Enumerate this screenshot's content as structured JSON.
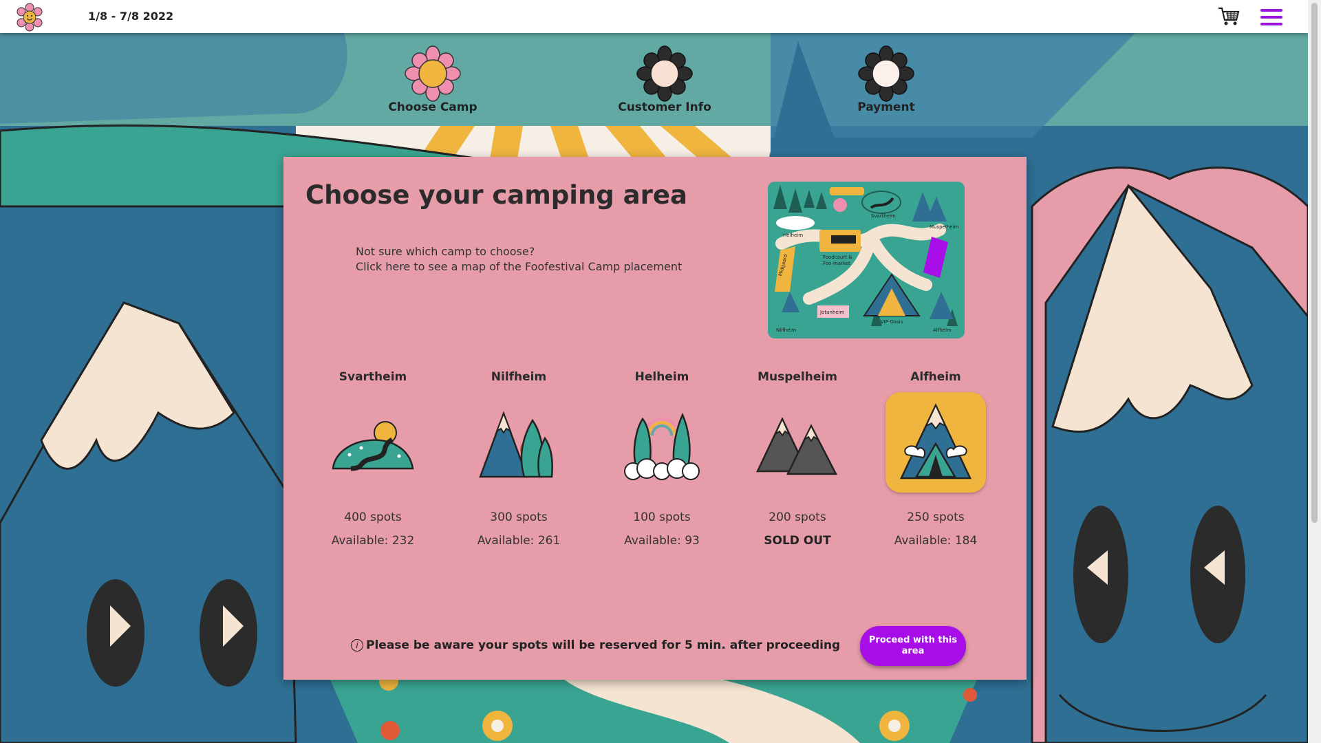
{
  "header": {
    "date_range": "1/8 - 7/8 2022",
    "logo_icon": "flower-logo-icon",
    "cart_icon": "shopping-cart-icon",
    "menu_icon": "hamburger-menu-icon"
  },
  "steps": [
    {
      "label": "Choose Camp",
      "active": true
    },
    {
      "label": "Customer Info",
      "active": false
    },
    {
      "label": "Payment",
      "active": false
    }
  ],
  "main": {
    "title": "Choose your camping area",
    "help_line1": "Not sure which camp to choose?",
    "help_line2": "Click here to see a map of the Foofestival Camp placement",
    "notice": "Please be aware your spots will be reserved for 5 min. after proceeding",
    "proceed_label": "Proceed with this area"
  },
  "camps": [
    {
      "name": "Svartheim",
      "spots": "400 spots",
      "available": "Available: 232"
    },
    {
      "name": "Nilfheim",
      "spots": "300 spots",
      "available": "Available: 261"
    },
    {
      "name": "Helheim",
      "spots": "100 spots",
      "available": "Available: 93"
    },
    {
      "name": "Muspelheim",
      "spots": "200 spots",
      "available": "SOLD OUT"
    },
    {
      "name": "Alfheim",
      "spots": "250 spots",
      "available": "Available: 184",
      "selected": true
    }
  ],
  "map_labels": {
    "helheim": "Helheim",
    "svartheim": "Svartheim",
    "muspelheim": "Muspelheim",
    "foodcourt": "Foodcourt &",
    "foomarket": "Foo-market",
    "midgaard": "Midgaard",
    "jotunheim": "Jotunheim",
    "vip": "VIP Oasis",
    "nilfheim": "Nilfheim",
    "alfheim": "Alfheim"
  },
  "colors": {
    "accent": "#a70ee8",
    "panel": "#e69ca9",
    "selected_bg": "#f0b53f",
    "menu": "#9b12d9"
  }
}
